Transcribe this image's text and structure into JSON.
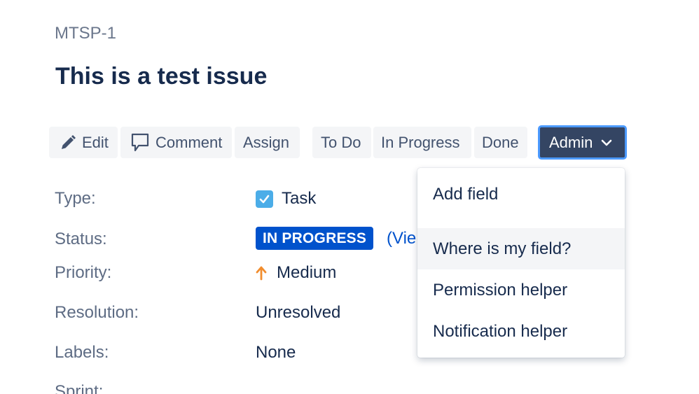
{
  "issue": {
    "key": "MTSP-1",
    "title": "This is a test issue"
  },
  "toolbar": {
    "edit_label": "Edit",
    "comment_label": "Comment",
    "assign_label": "Assign",
    "todo_label": "To Do",
    "in_progress_label": "In Progress",
    "done_label": "Done",
    "admin_label": "Admin"
  },
  "fields": {
    "type": {
      "label": "Type:",
      "value": "Task",
      "icon": "task-checkbox-icon"
    },
    "status": {
      "label": "Status:",
      "value": "IN PROGRESS",
      "link": "(Vie"
    },
    "priority": {
      "label": "Priority:",
      "value": "Medium",
      "icon": "arrow-up-icon"
    },
    "resolution": {
      "label": "Resolution:",
      "value": "Unresolved"
    },
    "labels": {
      "label": "Labels:",
      "value": "None"
    },
    "sprint": {
      "label": "Sprint:"
    }
  },
  "admin_menu": {
    "items": [
      {
        "label": "Add field"
      },
      {
        "label": "Where is my field?"
      },
      {
        "label": "Permission helper"
      },
      {
        "label": "Notification helper"
      }
    ]
  },
  "colors": {
    "admin_button_bg": "#344563",
    "focus_ring": "#4c9aff",
    "status_badge_bg": "#0052cc",
    "priority_medium": "#f18d2e",
    "task_icon": "#4bade8"
  }
}
